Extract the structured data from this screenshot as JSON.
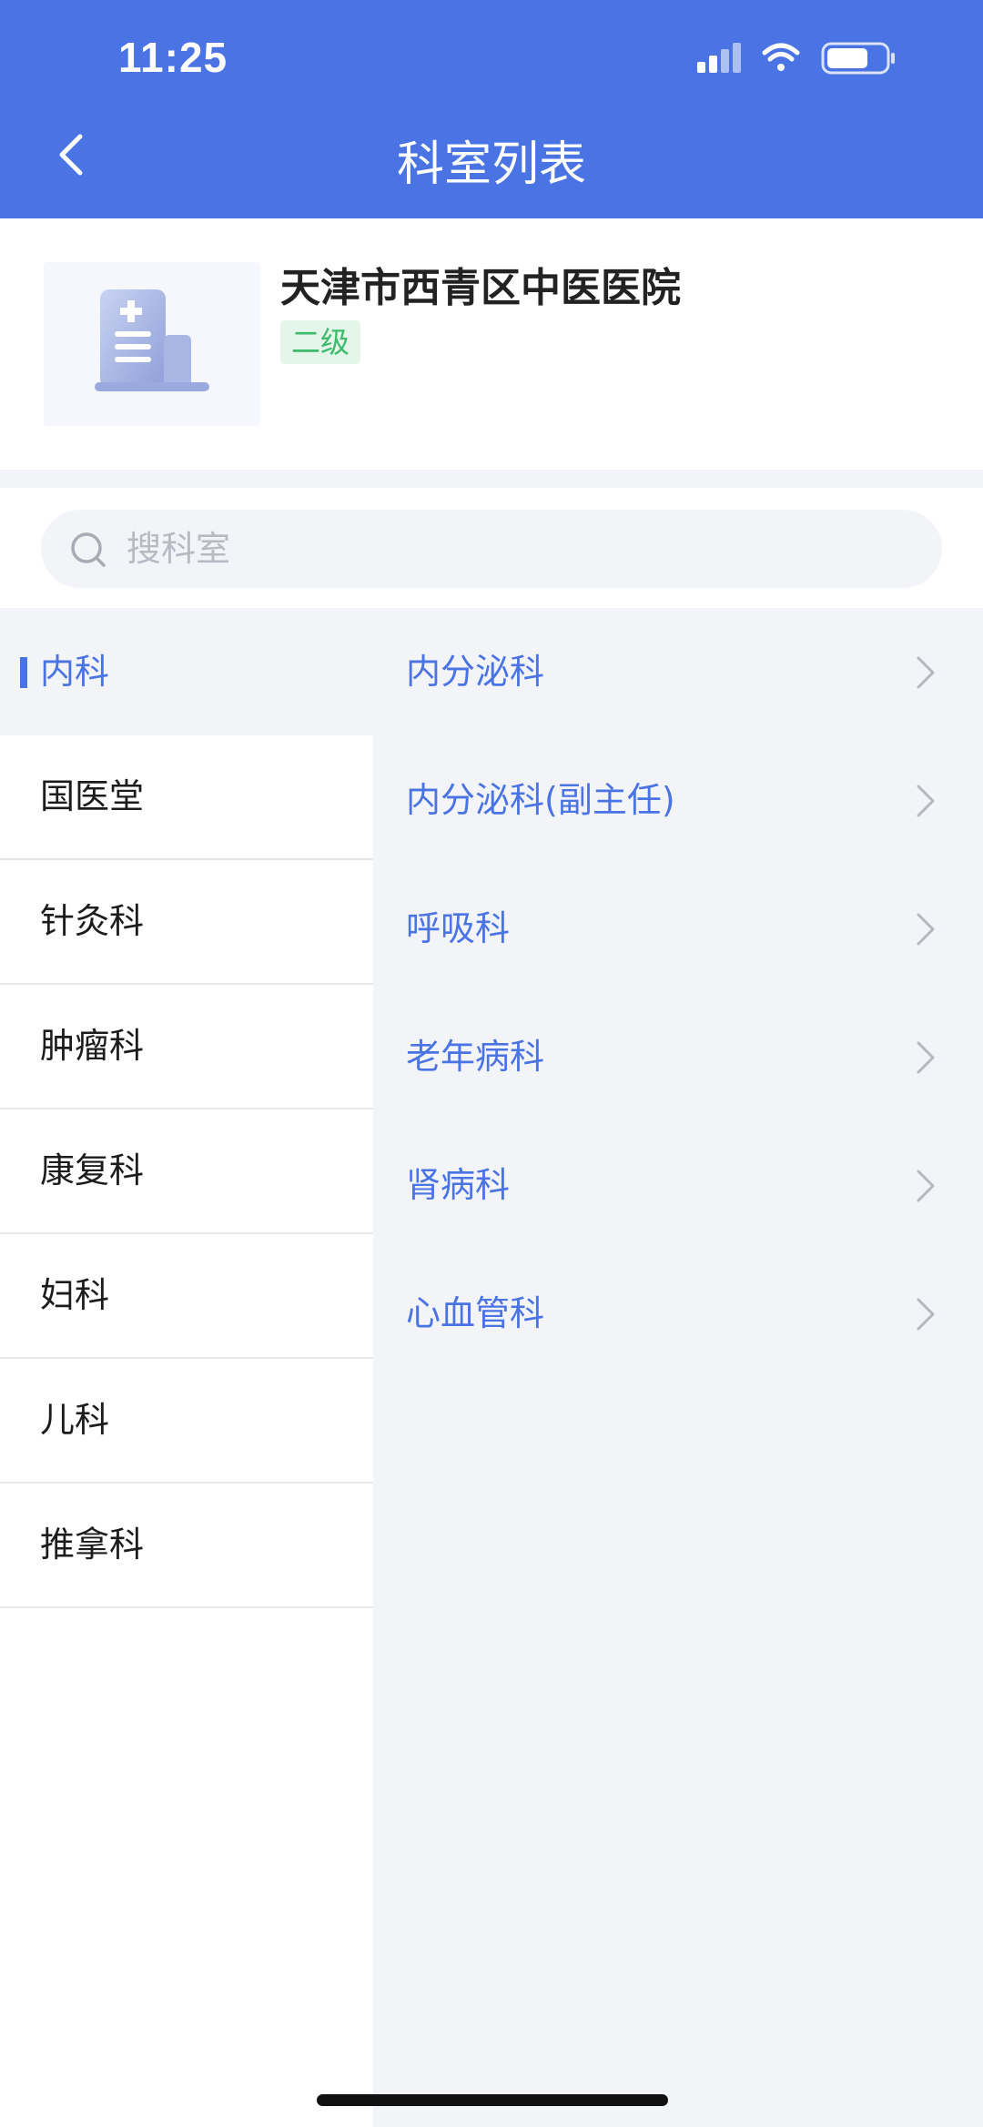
{
  "status_bar": {
    "time": "11:25"
  },
  "nav": {
    "title": "科室列表"
  },
  "hospital": {
    "name": "天津市西青区中医医院",
    "level": "二级"
  },
  "search": {
    "placeholder": "搜科室"
  },
  "categories": [
    {
      "label": "内科",
      "active": true
    },
    {
      "label": "国医堂"
    },
    {
      "label": "针灸科"
    },
    {
      "label": "肿瘤科"
    },
    {
      "label": "康复科"
    },
    {
      "label": "妇科"
    },
    {
      "label": "儿科"
    },
    {
      "label": "推拿科"
    }
  ],
  "departments": [
    {
      "label": "内分泌科"
    },
    {
      "label": "内分泌科(副主任)"
    },
    {
      "label": "呼吸科"
    },
    {
      "label": "老年病科"
    },
    {
      "label": "肾病科"
    },
    {
      "label": "心血管科"
    }
  ],
  "colors": {
    "primary": "#4a73e3",
    "level_bg": "#e4f6ea",
    "level_text": "#3dbb6b",
    "panel_bg": "#f2f4f8"
  }
}
